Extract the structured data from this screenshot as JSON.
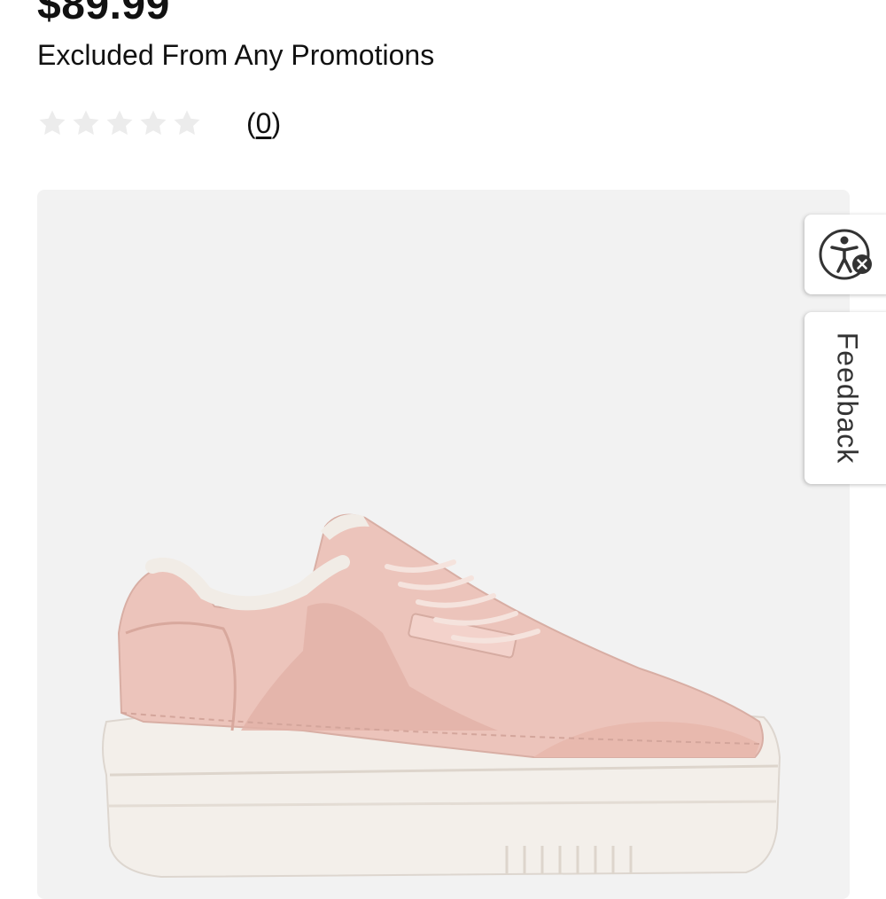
{
  "product": {
    "price": "$89.99",
    "promo_note": "Excluded From Any Promotions",
    "rating": {
      "value": 0,
      "max": 5,
      "count_open": "(",
      "count": "0",
      "count_close": ")"
    },
    "image": {
      "alt": "Pink leather platform sneaker",
      "colors": {
        "upper": "#ecc3bb",
        "sole": "#f2eeea",
        "background": "#f2f2f2"
      }
    }
  },
  "side_tabs": {
    "accessibility_icon": "accessibility-icon",
    "feedback_label": "Feedback"
  }
}
